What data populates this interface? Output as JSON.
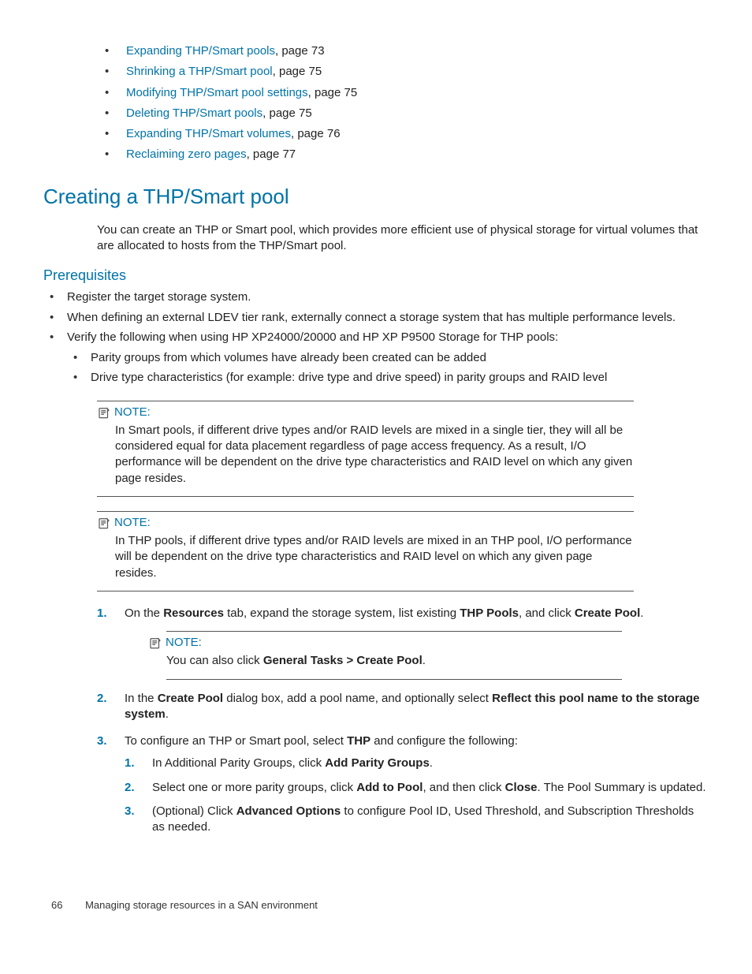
{
  "toc": [
    {
      "link": "Expanding THP/Smart pools",
      "suffix": ", page 73"
    },
    {
      "link": "Shrinking a THP/Smart pool",
      "suffix": ", page 75"
    },
    {
      "link": "Modifying THP/Smart pool settings",
      "suffix": ", page 75"
    },
    {
      "link": "Deleting THP/Smart pools",
      "suffix": ", page 75"
    },
    {
      "link": "Expanding THP/Smart volumes",
      "suffix": ", page 76"
    },
    {
      "link": "Reclaiming zero pages",
      "suffix": ", page 77"
    }
  ],
  "section_title": "Creating a THP/Smart pool",
  "intro": "You can create an THP or Smart pool, which provides more efficient use of physical storage for virtual volumes that are allocated to hosts from the THP/Smart pool.",
  "prereq_heading": "Prerequisites",
  "prereq": {
    "b1": "Register the target storage system.",
    "b2": "When defining an external LDEV tier rank, externally connect a storage system that has multiple performance levels.",
    "b3": "Verify the following when using HP XP24000/20000 and HP XP P9500 Storage for THP pools:",
    "b3a": "Parity groups from which volumes have already been created can be added",
    "b3b": "Drive type characteristics (for example: drive type and drive speed) in parity groups and RAID level"
  },
  "note_label": "NOTE:",
  "note1": "In Smart pools, if different drive types and/or RAID levels are mixed in a single tier, they will all be considered equal for data placement regardless of page access frequency. As a result, I/O performance will be dependent on the drive type characteristics and RAID level on which any given page resides.",
  "note2": "In THP pools, if different drive types and/or RAID levels are mixed in an THP pool, I/O performance will be dependent on the drive type characteristics and RAID level on which any given page resides.",
  "step1": {
    "pre": "On the ",
    "b1": "Resources",
    "mid1": " tab, expand the storage system, list existing ",
    "b2": "THP Pools",
    "mid2": ", and click ",
    "b3": "Create Pool",
    "end": "."
  },
  "note3": {
    "pre": "You can also click ",
    "b": "General Tasks > Create Pool",
    "end": "."
  },
  "step2": {
    "pre": "In the ",
    "b1": "Create Pool",
    "mid": " dialog box, add a pool name, and optionally select ",
    "b2": "Reflect this pool name to the storage system",
    "end": "."
  },
  "step3": {
    "pre": "To configure an THP or Smart pool, select ",
    "b": "THP",
    "end": " and configure the following:"
  },
  "sub1": {
    "pre": "In Additional Parity Groups, click ",
    "b": "Add Parity Groups",
    "end": "."
  },
  "sub2": {
    "pre": "Select one or more parity groups, click ",
    "b1": "Add to Pool",
    "mid": ", and then click ",
    "b2": "Close",
    "end": ". The Pool Summary is updated."
  },
  "sub3": {
    "pre": "(Optional) Click ",
    "b": "Advanced Options",
    "end": " to configure Pool ID, Used Threshold, and Subscription Thresholds as needed."
  },
  "footer": {
    "page": "66",
    "title": "Managing storage resources in a SAN environment"
  }
}
